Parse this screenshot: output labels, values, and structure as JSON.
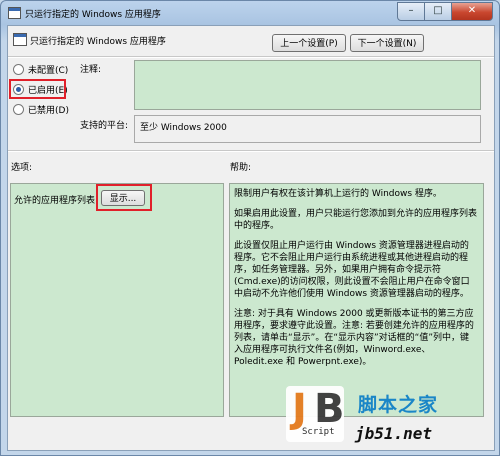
{
  "window": {
    "title": "只运行指定的 Windows 应用程序",
    "minimize": "–",
    "maximize": "□",
    "close": "✕"
  },
  "header": {
    "title": "只运行指定的 Windows 应用程序",
    "prev_button": "上一个设置(P)",
    "next_button": "下一个设置(N)"
  },
  "options": [
    {
      "label": "未配置(C)",
      "selected": false
    },
    {
      "label": "已启用(E)",
      "selected": true
    },
    {
      "label": "已禁用(D)",
      "selected": false
    }
  ],
  "comment_label": "注释:",
  "platform": {
    "label": "支持的平台:",
    "value": "至少 Windows 2000"
  },
  "options_section": {
    "label": "选项:",
    "list_label": "允许的应用程序列表",
    "show_button": "显示..."
  },
  "help": {
    "label": "帮助:",
    "paragraphs": [
      "限制用户有权在该计算机上运行的 Windows 程序。",
      "如果启用此设置，用户只能运行您添加到允许的应用程序列表中的程序。",
      "此设置仅阻止用户运行由 Windows 资源管理器进程启动的程序。它不会阻止用户运行由系统进程或其他进程启动的程序，如任务管理器。另外，如果用户拥有命令提示符(Cmd.exe)的访问权限，则此设置不会阻止用户在命令窗口中启动不允许他们使用 Windows 资源管理器启动的程序。",
      "注意: 对于具有 Windows 2000 或更新版本证书的第三方应用程序，要求遵守此设置。注意: 若要创建允许的应用程序的列表，请单击“显示”。在“显示内容”对话框的“值”列中，键入应用程序可执行文件名(例如，Winword.exe、Poledit.exe 和 Powerpnt.exe)。"
    ]
  },
  "watermark": {
    "logo_j": "J",
    "logo_b": "B",
    "logo_script": "Script",
    "site_name": "脚本之家",
    "url": "jb51.net"
  },
  "colors": {
    "highlight": "#e0202a",
    "panel_green": "#cce8cf",
    "accent_blue": "#2c5ea8"
  }
}
